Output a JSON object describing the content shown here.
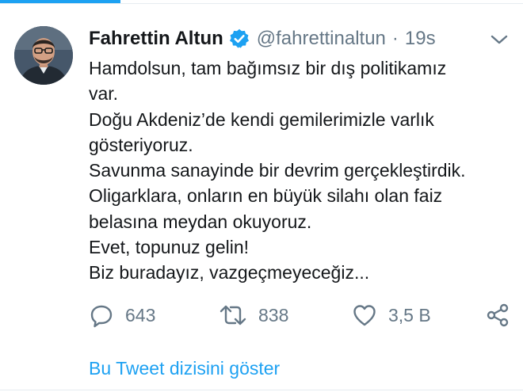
{
  "tweet": {
    "author_name": "Fahrettin Altun",
    "author_handle": "@fahrettinaltun",
    "separator": "·",
    "timestamp": "19s",
    "lines": [
      "Hamdolsun, tam bağımsız bir dış politikamız",
      "var.",
      "Doğu Akdeniz’de kendi gemilerimizle varlık",
      "gösteriyoruz.",
      "Savunma sanayinde bir devrim gerçekleştirdik.",
      "Oligarklara, onların en büyük silahı olan faiz",
      "belasına meydan okuyoruz.",
      "Evet, topunuz gelin!",
      "Biz buradayız, vazgeçmeyeceğiz..."
    ]
  },
  "actions": {
    "reply_count": "643",
    "retweet_count": "838",
    "like_count": "3,5 B"
  },
  "thread_link_label": "Bu Tweet dizisini göster",
  "icons": {
    "verified": "verified-badge-icon",
    "menu": "chevron-down-icon",
    "reply": "reply-icon",
    "retweet": "retweet-icon",
    "like": "heart-icon",
    "share": "share-icon"
  },
  "colors": {
    "accent": "#1da1f2",
    "text": "#14171a",
    "muted": "#657786"
  }
}
